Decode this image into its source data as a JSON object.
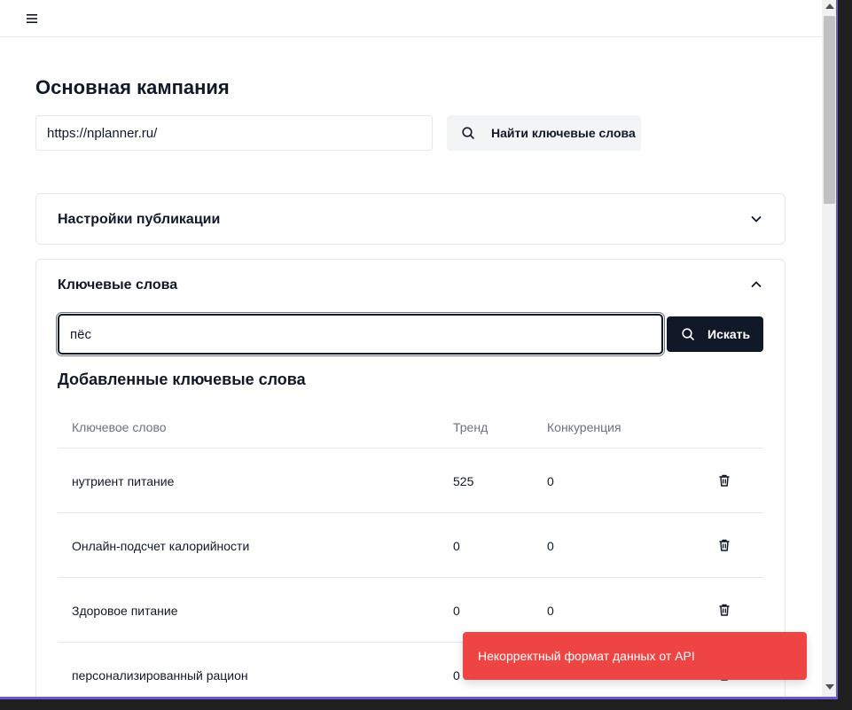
{
  "campaign": {
    "title": "Основная кампания",
    "url_value": "https://nplanner.ru/",
    "find_button_label": "Найти ключевые слова"
  },
  "settings_section": {
    "title": "Настройки публикации",
    "expanded": false
  },
  "keywords_section": {
    "title": "Ключевые слова",
    "expanded": true,
    "search_value": "пёс",
    "search_button_label": "Искать",
    "added_title": "Добавленные ключевые слова",
    "columns": [
      "Ключевое слово",
      "Тренд",
      "Конкуренция"
    ],
    "rows": [
      {
        "keyword": "нутриент питание",
        "trend": "525",
        "competition": "0"
      },
      {
        "keyword": "Онлайн-подсчет калорийности",
        "trend": "0",
        "competition": "0"
      },
      {
        "keyword": "Здоровое питание",
        "trend": "0",
        "competition": "0"
      },
      {
        "keyword": "персонализированный рацион",
        "trend": "0",
        "competition": ""
      }
    ]
  },
  "toast": {
    "message": "Некорректный формат данных от API",
    "color": "#ef4444"
  },
  "icons": {
    "menu": "hamburger-icon",
    "search": "search-icon",
    "expand": "chevron-down-icon",
    "collapse": "chevron-up-icon",
    "delete": "trash-icon"
  }
}
